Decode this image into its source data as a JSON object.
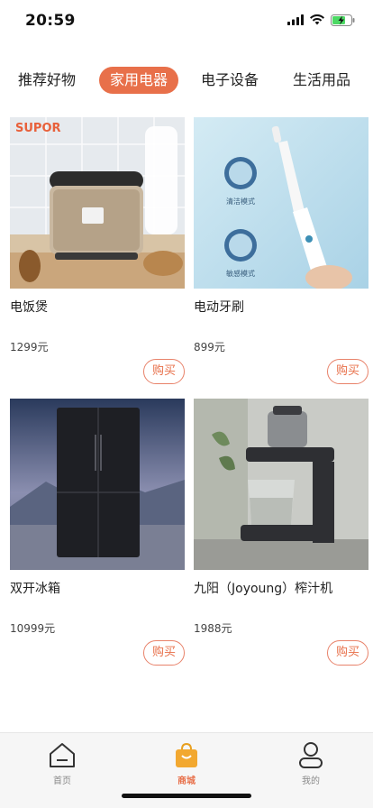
{
  "status_bar": {
    "time": "20:59"
  },
  "tabs": [
    {
      "label": "推荐好物",
      "active": false
    },
    {
      "label": "家用电器",
      "active": true
    },
    {
      "label": "电子设备",
      "active": false
    },
    {
      "label": "生活用品",
      "active": false
    }
  ],
  "products": [
    {
      "name": "电饭煲",
      "price": "1299元",
      "buy_label": "购买",
      "brand_text": "SUPOR"
    },
    {
      "name": "电动牙刷",
      "price": "899元",
      "buy_label": "购买",
      "mode_text_1": "清洁模式",
      "mode_text_2": "敏感模式"
    },
    {
      "name": "双开冰箱",
      "price": "10999元",
      "buy_label": "购买"
    },
    {
      "name": "九阳（Joyoung）榨汁机",
      "price": "1988元",
      "buy_label": "购买"
    }
  ],
  "bottom_nav": [
    {
      "label": "首页",
      "icon": "home-icon",
      "active": false
    },
    {
      "label": "商城",
      "icon": "shopping-bag-icon",
      "active": true
    },
    {
      "label": "我的",
      "icon": "user-icon",
      "active": false
    }
  ],
  "colors": {
    "accent": "#e8704a"
  }
}
